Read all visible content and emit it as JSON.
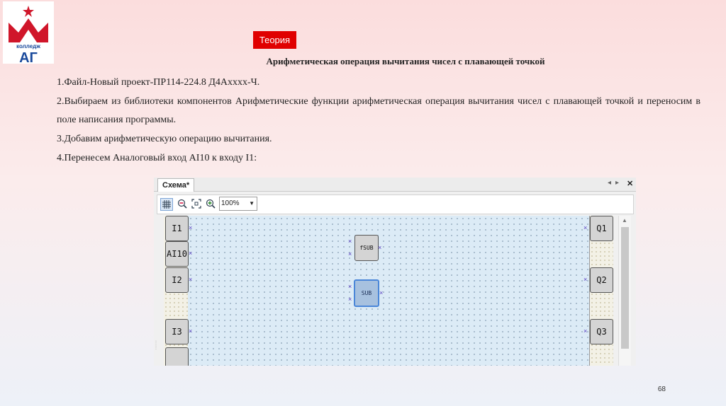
{
  "logo": {
    "text": "колледж",
    "monogram": "АГ"
  },
  "badge": "Теория",
  "title": "Арифметическая операция вычитания чисел с плавающей точкой",
  "steps": [
    "1.Файл-Новый проект-ПР114-224.8 Д4Аxxxx-Ч.",
    "2.Выбираем из библиотеки компонентов Арифметические функции арифметическая операция вычитания чисел с плавающей точкой и переносим в поле написания программы.",
    "3.Добавим арифметическую операцию вычитания.",
    "4.Перенесем Аналоговый вход AI10 к входу I1:"
  ],
  "editor": {
    "tab_label": "Схема*",
    "zoom_value": "100%",
    "inputs": [
      "I1",
      "AI10",
      "I2",
      "I3"
    ],
    "outputs": [
      "Q1",
      "Q2",
      "Q3"
    ],
    "blocks": {
      "fsub": "fSUB",
      "sub": "SUB"
    }
  },
  "page_number": "68",
  "colors": {
    "badge": "#e00000",
    "canvas": "#dcebf6",
    "selected_block": "#a7c1df",
    "selected_border": "#4a86d8"
  }
}
